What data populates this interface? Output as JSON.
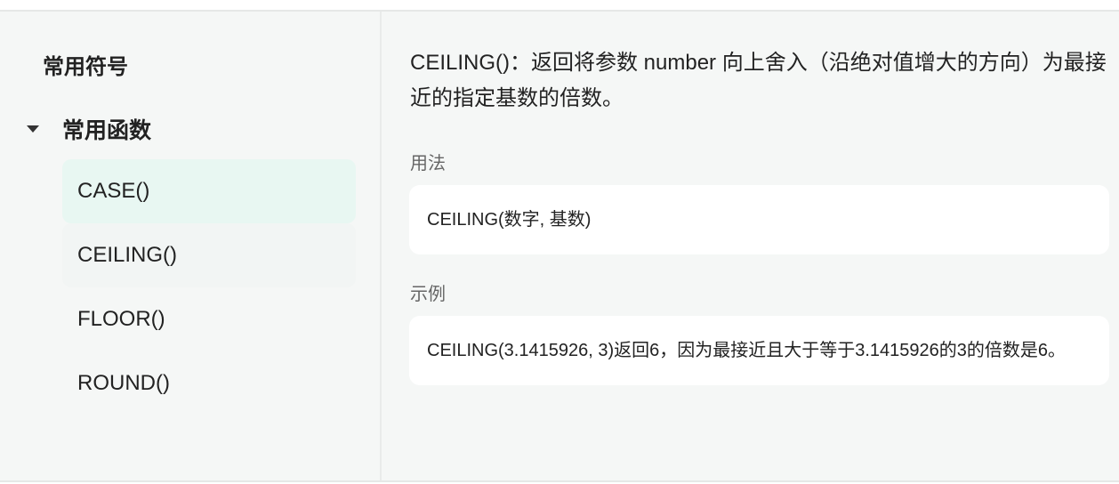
{
  "sidebar": {
    "section_title": "常用符号",
    "group_label": "常用函数",
    "items": [
      {
        "label": "CASE()"
      },
      {
        "label": "CEILING()"
      },
      {
        "label": "FLOOR()"
      },
      {
        "label": "ROUND()"
      }
    ]
  },
  "detail": {
    "description": "CEILING()：返回将参数 number 向上舍入（沿绝对值增大的方向）为最接近的指定基数的倍数。",
    "usage_label": "用法",
    "usage": "CEILING(数字, 基数)",
    "example_label": "示例",
    "example": "CEILING(3.1415926, 3)返回6，因为最接近且大于等于3.1415926的3的倍数是6。"
  },
  "colors": {
    "selected_bg": "#e8f7f2",
    "panel_bg": "#f5f7f6"
  }
}
